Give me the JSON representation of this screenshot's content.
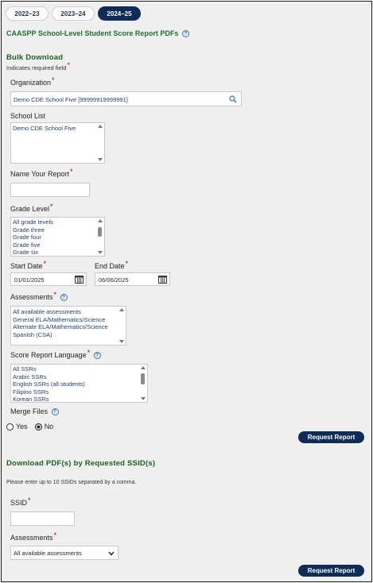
{
  "year_tabs": [
    {
      "label": "2022–23",
      "active": false
    },
    {
      "label": "2023–24",
      "active": false
    },
    {
      "label": "2024–25",
      "active": true
    }
  ],
  "page_title": "CAASPP School-Level Student Score Report PDFs",
  "bulk": {
    "heading": "Bulk Download",
    "required_note": "Indicates required field",
    "organization": {
      "label": "Organization",
      "value": "Demo CDE School Five [99999919999991]"
    },
    "school_list": {
      "label": "School List",
      "items": [
        "Demo CDE School Five"
      ]
    },
    "report_name": {
      "label": "Name Your Report",
      "value": ""
    },
    "grade_level": {
      "label": "Grade Level",
      "items": [
        "All grade levels",
        "Grade three",
        "Grade four",
        "Grade five",
        "Grade six"
      ]
    },
    "start_date": {
      "label": "Start Date",
      "value": "01/01/2025"
    },
    "end_date": {
      "label": "End Date",
      "value": "06/06/2025"
    },
    "assessments": {
      "label": "Assessments",
      "items": [
        "All available assessments",
        "General ELA/Mathematics/Science",
        "Alternate ELA/Mathematics/Science",
        "Spanish (CSA)"
      ]
    },
    "language": {
      "label": "Score Report Language",
      "items": [
        "All SSRs",
        "Arabic SSRs",
        "English SSRs (all students)",
        "Filipino SSRs",
        "Korean SSRs"
      ]
    },
    "merge": {
      "label": "Merge Files",
      "yes": "Yes",
      "no": "No",
      "selected": "No"
    },
    "submit": "Request Report"
  },
  "ssid": {
    "heading": "Download PDF(s) by Requested SSID(s)",
    "instructions": "Please enter up to 10 SSIDs separated by a comma.",
    "ssid_field": {
      "label": "SSID",
      "value": ""
    },
    "assessments": {
      "label": "Assessments",
      "value": "All available assessments"
    },
    "submit": "Request Report"
  },
  "colors": {
    "navy": "#0e2c55",
    "green": "#1f6f2e",
    "required": "#b00000",
    "link": "#1f3f6f"
  },
  "icons": {
    "search": "magnifier",
    "calendar": "calendar",
    "help": "question-circle",
    "dropdown": "chevron-down"
  }
}
